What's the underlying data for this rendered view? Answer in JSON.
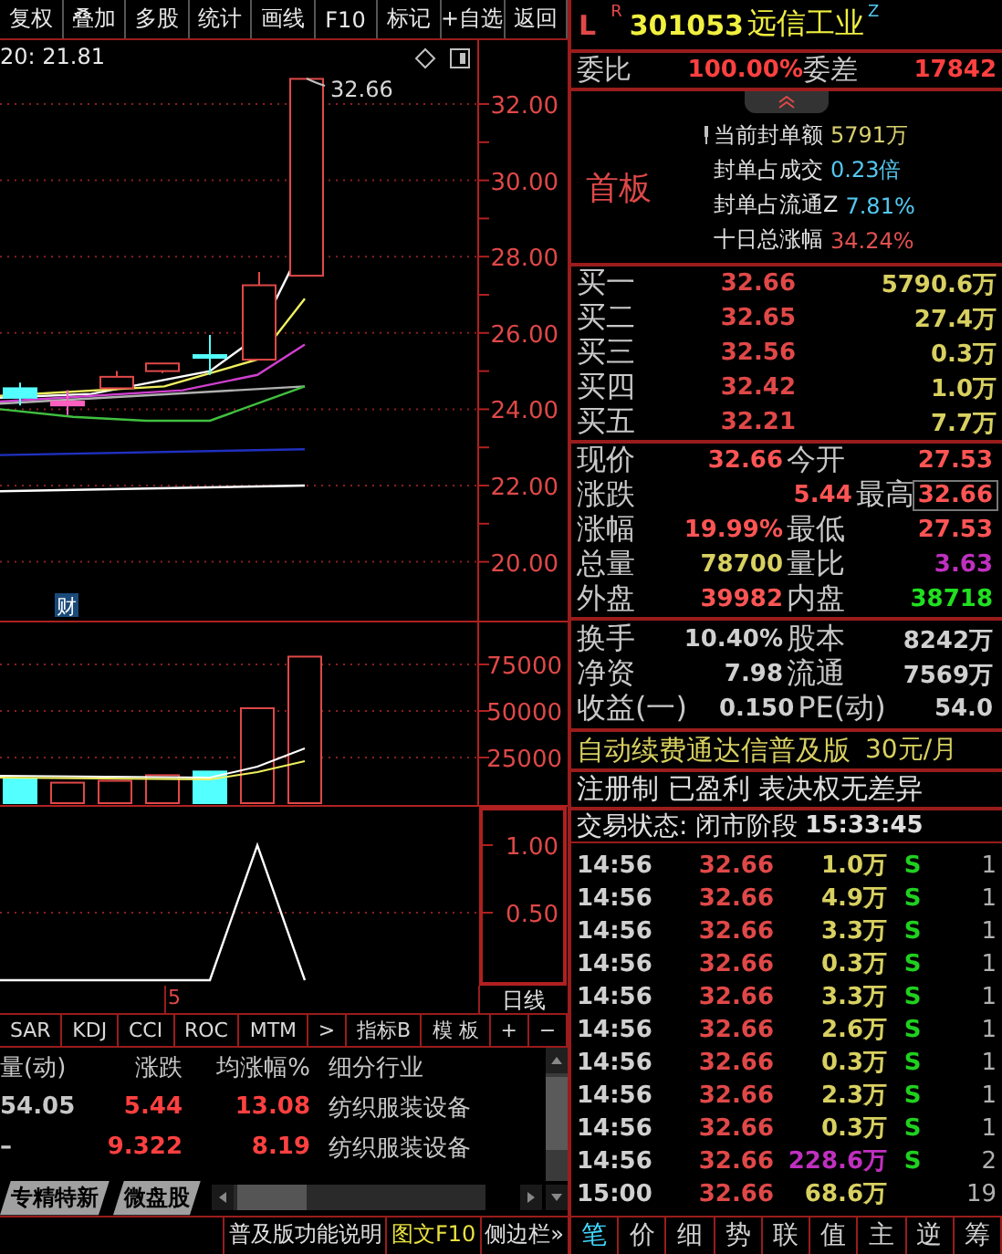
{
  "toolbar": [
    "复权",
    "叠加",
    "多股",
    "统计",
    "画线",
    "F10",
    "标记",
    "+自选",
    "返回"
  ],
  "price_chart": {
    "ma_label": "20: 21.81",
    "high_label": "32.66",
    "news_badge": "财",
    "axis_labels": [
      "32.00",
      "30.00",
      "28.00",
      "26.00",
      "24.00",
      "22.00",
      "20.00"
    ]
  },
  "volume_chart": {
    "axis_labels": [
      "75000",
      "50000",
      "25000"
    ]
  },
  "indicator_chart": {
    "axis_labels": [
      "1.00",
      "0.50"
    ]
  },
  "date_axis": {
    "label": "5",
    "period": "日线"
  },
  "indicator_tabs": [
    "SAR",
    "KDJ",
    "CCI",
    "ROC",
    "MTM",
    ">",
    "指标B",
    "模 板",
    "+",
    "−"
  ],
  "table": {
    "columns": [
      "量(动)",
      "涨跌",
      "均涨幅%",
      "细分行业"
    ],
    "rows": [
      [
        "54.05",
        "5.44",
        "13.08",
        "纺织服装设备"
      ],
      [
        "–",
        "9.322",
        "8.19",
        "纺织服装设备"
      ]
    ]
  },
  "sheet_tabs": [
    "专精特新",
    "微盘股"
  ],
  "status_bar": [
    {
      "label": "普及版功能说明",
      "highlight": false
    },
    {
      "label": "图文F10",
      "highlight": true
    },
    {
      "label": "侧边栏»",
      "highlight": false
    }
  ],
  "stock": {
    "market": "L",
    "mark": "R",
    "code": "301053",
    "name": "远信工业",
    "suffix": "Z"
  },
  "order_ratio": {
    "label": "委比",
    "value": "100.00%",
    "diff_label": "委差",
    "diff": "17842"
  },
  "board": {
    "title": "首板",
    "stats": [
      {
        "label": "当前封单额",
        "value": "5791万",
        "color": "#d8d070"
      },
      {
        "label": "封单占成交",
        "value": "0.23倍",
        "color": "#54c8f0"
      },
      {
        "label": "封单占流通Z",
        "value": "7.81%",
        "color": "#54c8f0"
      },
      {
        "label": "十日总涨幅",
        "value": "34.24%",
        "color": "#e05050"
      }
    ]
  },
  "bids": [
    {
      "label": "买一",
      "price": "32.66",
      "volume": "5790.6万"
    },
    {
      "label": "买二",
      "price": "32.65",
      "volume": "27.4万"
    },
    {
      "label": "买三",
      "price": "32.56",
      "volume": "0.3万"
    },
    {
      "label": "买四",
      "price": "32.42",
      "volume": "1.0万"
    },
    {
      "label": "买五",
      "price": "32.21",
      "volume": "7.7万"
    }
  ],
  "quote": [
    {
      "label": "现价",
      "value": "32.66",
      "color": "#ff5454",
      "highlighted": false
    },
    {
      "label": "今开",
      "value": "27.53",
      "color": "#ff5454",
      "highlighted": false
    },
    {
      "label": "涨跌",
      "value": "5.44",
      "color": "#ff5454",
      "highlighted": false
    },
    {
      "label": "最高",
      "value": "32.66",
      "color": "#ff5454",
      "highlighted": true
    },
    {
      "label": "涨幅",
      "value": "19.99%",
      "color": "#ff5454",
      "highlighted": false
    },
    {
      "label": "最低",
      "value": "27.53",
      "color": "#ff5454",
      "highlighted": false
    },
    {
      "label": "总量",
      "value": "78700",
      "color": "#d8d060",
      "highlighted": false
    },
    {
      "label": "量比",
      "value": "3.63",
      "color": "#c030c0",
      "highlighted": false
    },
    {
      "label": "外盘",
      "value": "39982",
      "color": "#ff5454",
      "highlighted": false
    },
    {
      "label": "内盘",
      "value": "38718",
      "color": "#20e020",
      "highlighted": false
    }
  ],
  "fundamentals": [
    {
      "label": "换手",
      "value": "10.40%"
    },
    {
      "label": "股本",
      "value": "8242万"
    },
    {
      "label": "净资",
      "value": "7.98"
    },
    {
      "label": "流通",
      "value": "7569万"
    },
    {
      "label": "收益(一)",
      "value": "0.150"
    },
    {
      "label": "PE(动)",
      "value": "54.0"
    }
  ],
  "promo": {
    "text": "自动续费通达信普及版",
    "price": "30元/月"
  },
  "tags": "注册制 已盈利 表决权无差异",
  "trade_status": {
    "label": "交易状态: 闭市阶段",
    "time": "15:33:45"
  },
  "trades": [
    {
      "time": "14:56",
      "price": "32.66",
      "volume": "1.0万",
      "side": "S",
      "count": "1",
      "large": false
    },
    {
      "time": "14:56",
      "price": "32.66",
      "volume": "4.9万",
      "side": "S",
      "count": "1",
      "large": false
    },
    {
      "time": "14:56",
      "price": "32.66",
      "volume": "3.3万",
      "side": "S",
      "count": "1",
      "large": false
    },
    {
      "time": "14:56",
      "price": "32.66",
      "volume": "0.3万",
      "side": "S",
      "count": "1",
      "large": false
    },
    {
      "time": "14:56",
      "price": "32.66",
      "volume": "3.3万",
      "side": "S",
      "count": "1",
      "large": false
    },
    {
      "time": "14:56",
      "price": "32.66",
      "volume": "2.6万",
      "side": "S",
      "count": "1",
      "large": false
    },
    {
      "time": "14:56",
      "price": "32.66",
      "volume": "0.3万",
      "side": "S",
      "count": "1",
      "large": false
    },
    {
      "time": "14:56",
      "price": "32.66",
      "volume": "2.3万",
      "side": "S",
      "count": "1",
      "large": false
    },
    {
      "time": "14:56",
      "price": "32.66",
      "volume": "0.3万",
      "side": "S",
      "count": "1",
      "large": false
    },
    {
      "time": "14:56",
      "price": "32.66",
      "volume": "228.6万",
      "side": "S",
      "count": "2",
      "large": true
    },
    {
      "time": "15:00",
      "price": "32.66",
      "volume": "68.6万",
      "count": "19",
      "large": false
    }
  ],
  "detail_tabs": [
    {
      "label": "笔",
      "selected": true
    },
    {
      "label": "价",
      "selected": false
    },
    {
      "label": "细",
      "selected": false
    },
    {
      "label": "势",
      "selected": false
    },
    {
      "label": "联",
      "selected": false
    },
    {
      "label": "值",
      "selected": false
    },
    {
      "label": "主",
      "selected": false
    },
    {
      "label": "逆",
      "selected": false
    },
    {
      "label": "筹",
      "selected": false
    }
  ]
}
